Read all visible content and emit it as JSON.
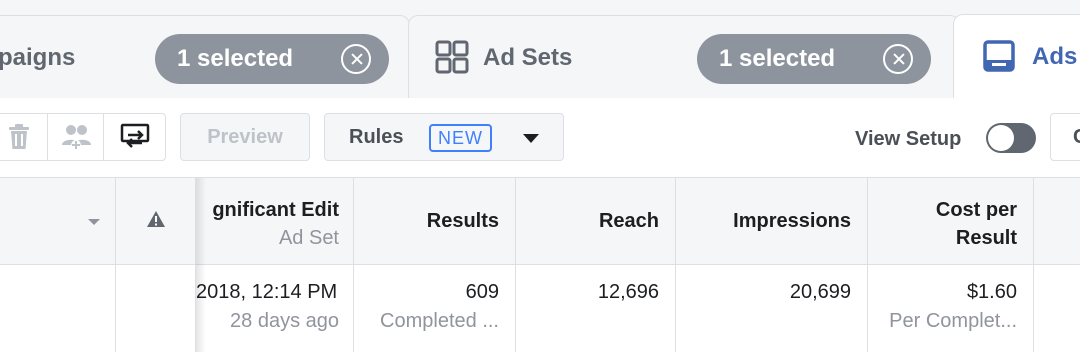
{
  "tabs": {
    "campaigns": {
      "label": "paigns",
      "selected": "1 selected"
    },
    "ad_sets": {
      "label": "Ad Sets",
      "selected": "1 selected"
    },
    "ads": {
      "label": "Ads"
    }
  },
  "toolbar": {
    "preview_label": "Preview",
    "rules_label": "Rules",
    "rules_badge": "NEW",
    "view_setup_label": "View Setup",
    "view_setup_on": false,
    "edge_label": "C"
  },
  "table": {
    "headers": {
      "significant_edit": "gnificant Edit",
      "significant_edit_sub": "Ad Set",
      "results": "Results",
      "reach": "Reach",
      "impressions": "Impressions",
      "cost_per_result_1": "Cost per",
      "cost_per_result_2": "Result"
    },
    "row": {
      "significant_edit": "2018, 12:14 PM",
      "significant_edit_sub": "28 days ago",
      "results": "609",
      "results_sub": "Completed ...",
      "reach": "12,696",
      "impressions": "20,699",
      "cost_per_result": "$1.60",
      "cost_per_result_sub": "Per Complet..."
    }
  },
  "colors": {
    "accent": "#4267b2",
    "pill": "#8d949e",
    "badge": "#4080ff"
  }
}
